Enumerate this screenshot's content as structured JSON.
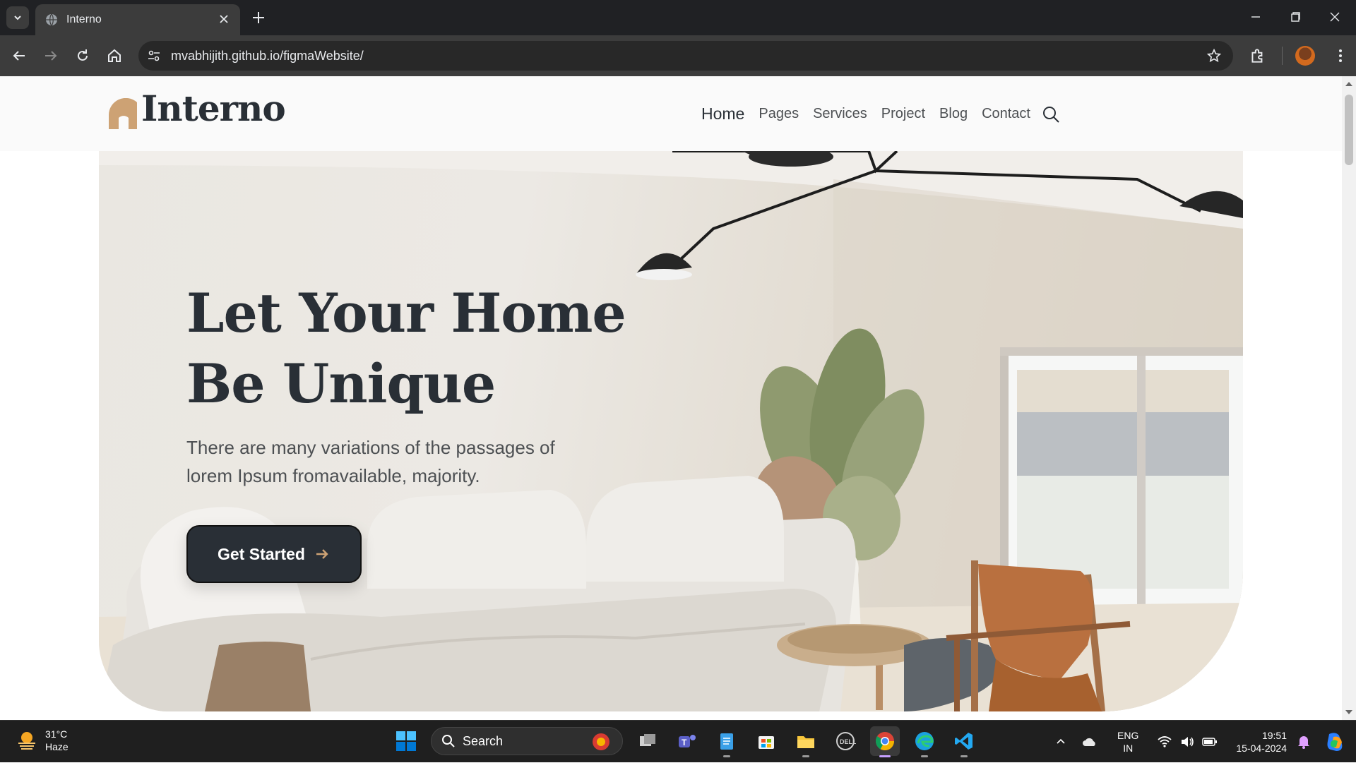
{
  "browser": {
    "tab_title": "Interno",
    "url": "mvabhijith.github.io/figmaWebsite/"
  },
  "site": {
    "logo_text": "Interno",
    "nav": [
      {
        "label": "Home",
        "active": true
      },
      {
        "label": "Pages"
      },
      {
        "label": "Services"
      },
      {
        "label": "Project"
      },
      {
        "label": "Blog"
      },
      {
        "label": "Contact"
      }
    ],
    "hero": {
      "title_line1": "Let Your Home",
      "title_line2": "Be Unique",
      "subtitle": "There are many variations of the passages of lorem Ipsum fromavailable, majority.",
      "cta": "Get Started"
    },
    "colors": {
      "accent": "#cda274",
      "dark": "#292f36",
      "text": "#4d5053"
    }
  },
  "taskbar": {
    "weather_temp": "31°C",
    "weather_desc": "Haze",
    "search_label": "Search",
    "lang_line1": "ENG",
    "lang_line2": "IN",
    "time": "19:51",
    "date": "15-04-2024"
  }
}
